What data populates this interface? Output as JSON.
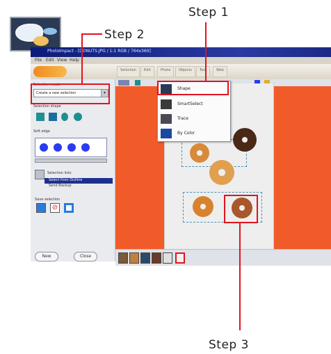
{
  "callouts": {
    "step1": "Step 1",
    "step2": "Step 2",
    "step3": "Step 3"
  },
  "window": {
    "title": "PhotoImpact - [DONUTS.JPG / 1:1 RGB / 764x360]",
    "menu": [
      "File",
      "Edit",
      "View",
      "Help"
    ],
    "ribbon_tabs": [
      "Selection",
      "Edit",
      "Photo",
      "Objects",
      "Text",
      "Web"
    ]
  },
  "left_panel": {
    "mode_label": "Selection mode",
    "mode_value": "Create a new selection",
    "shape_label": "Selection shape",
    "brush_label": "Soft edge",
    "list_label": "Selection lists",
    "list_items": [
      "Select from Outline",
      "Send Backup"
    ],
    "save_label": "Save selection",
    "new_button": "New",
    "close_button": "Close"
  },
  "dropdown_menu": {
    "items": [
      "Shape",
      "SmartSelect",
      "Trace",
      "By Color"
    ],
    "selected_index": 0
  },
  "colors": {
    "canvas_bg": "#f15b2a",
    "highlight": "#e0141e",
    "title_bar": "#0b1c7a"
  }
}
